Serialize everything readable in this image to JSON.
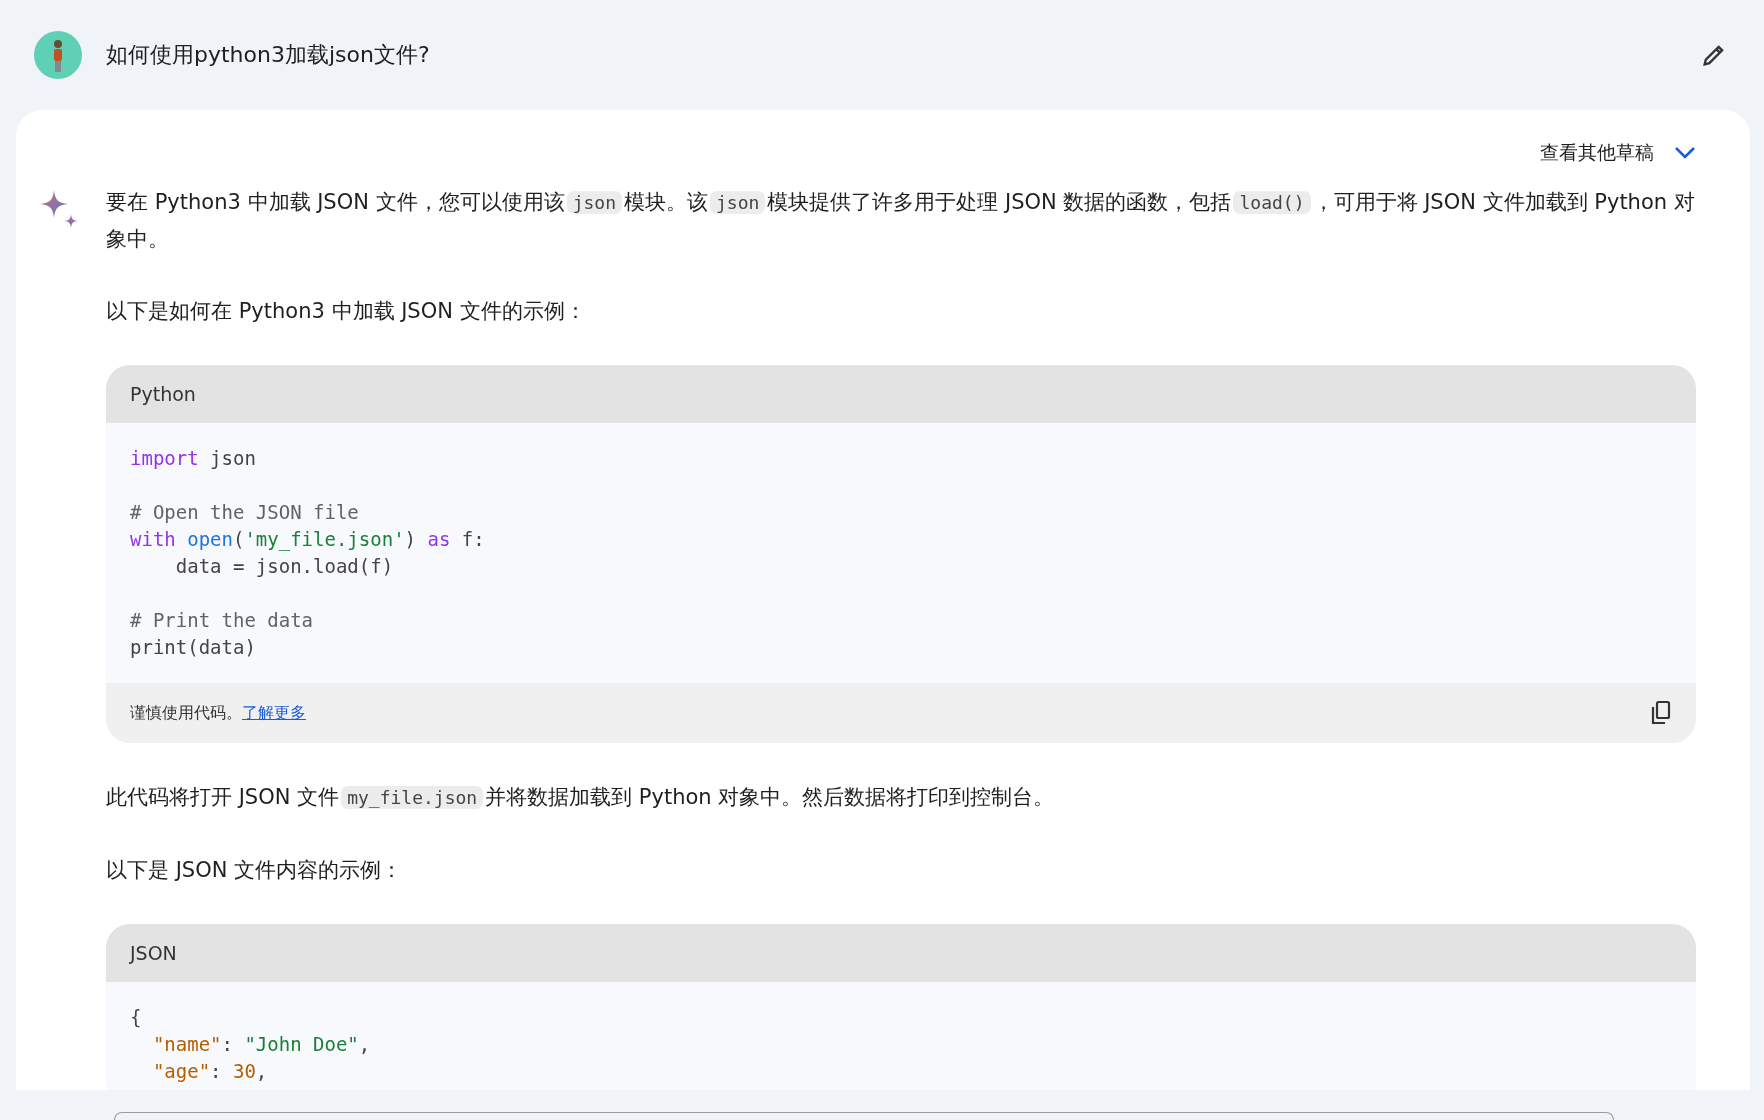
{
  "prompt": {
    "text": "如何使用python3加载json文件?"
  },
  "response": {
    "drafts_label": "查看其他草稿",
    "blocks": [
      {
        "kind": "paragraph",
        "segments": [
          {
            "kind": "text",
            "text": "要在 Python3 中加载 JSON 文件，您可以使用该"
          },
          {
            "kind": "code",
            "text": "json"
          },
          {
            "kind": "text",
            "text": "模块。该"
          },
          {
            "kind": "code",
            "text": "json"
          },
          {
            "kind": "text",
            "text": "模块提供了许多用于处理 JSON 数据的函数，包括"
          },
          {
            "kind": "code",
            "text": "load()"
          },
          {
            "kind": "text",
            "text": "，可用于将 JSON 文件加载到 Python 对象中。"
          }
        ]
      },
      {
        "kind": "paragraph",
        "segments": [
          {
            "kind": "text",
            "text": "以下是如何在 Python3 中加载 JSON 文件的示例："
          }
        ]
      },
      {
        "kind": "codeblock",
        "language": "Python",
        "notice": "谨慎使用代码。",
        "link": "了解更多",
        "groups": [
          [
            [
              {
                "kind": "keyword",
                "text": "import"
              },
              {
                "kind": "plain",
                "text": " json"
              }
            ]
          ],
          [
            [
              {
                "kind": "comment",
                "text": "# Open the JSON file"
              }
            ],
            [
              {
                "kind": "keyword",
                "text": "with"
              },
              {
                "kind": "builtin",
                "text": " open"
              },
              {
                "kind": "plain",
                "text": "("
              },
              {
                "kind": "string",
                "text": "'my_file.json'"
              },
              {
                "kind": "plain",
                "text": ") "
              },
              {
                "kind": "keyword",
                "text": "as"
              },
              {
                "kind": "plain",
                "text": " f:"
              }
            ],
            [
              {
                "kind": "plain",
                "text": "    data = json.load(f)"
              }
            ]
          ],
          [
            [
              {
                "kind": "comment",
                "text": "# Print the data"
              }
            ],
            [
              {
                "kind": "plain",
                "text": "print(data)"
              }
            ]
          ]
        ]
      },
      {
        "kind": "paragraph",
        "segments": [
          {
            "kind": "text",
            "text": "此代码将打开 JSON 文件"
          },
          {
            "kind": "code",
            "text": "my_file.json"
          },
          {
            "kind": "text",
            "text": "并将数据加载到 Python 对象中。然后数据将打印到控制台。"
          }
        ]
      },
      {
        "kind": "paragraph",
        "segments": [
          {
            "kind": "text",
            "text": "以下是 JSON 文件内容的示例："
          }
        ]
      },
      {
        "kind": "codeblock",
        "language": "JSON",
        "groups": [
          [
            [
              {
                "kind": "plain",
                "text": "{"
              }
            ],
            [
              {
                "kind": "key",
                "text": "  \"name\""
              },
              {
                "kind": "plain",
                "text": ": "
              },
              {
                "kind": "string",
                "text": "\"John Doe\""
              },
              {
                "kind": "plain",
                "text": ","
              }
            ],
            [
              {
                "kind": "key",
                "text": "  \"age\""
              },
              {
                "kind": "plain",
                "text": ": "
              },
              {
                "kind": "number",
                "text": "30"
              },
              {
                "kind": "plain",
                "text": ","
              }
            ]
          ]
        ]
      }
    ]
  }
}
